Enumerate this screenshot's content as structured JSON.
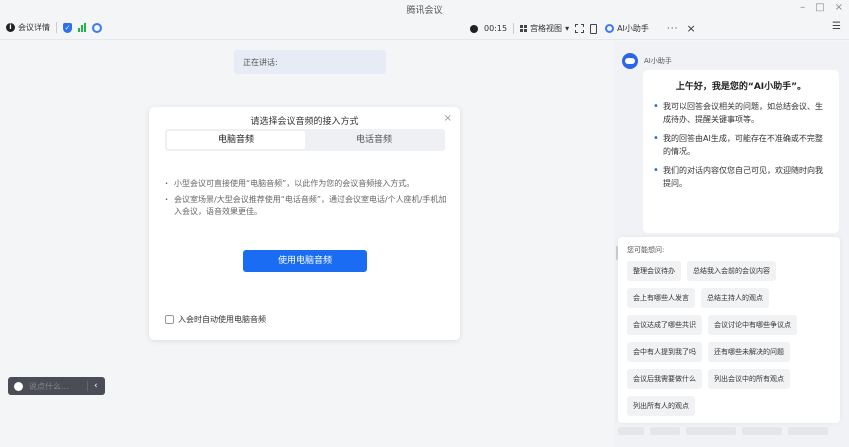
{
  "window": {
    "title": "腾讯会议",
    "controls": {
      "minimize": "–",
      "maximize": "□",
      "close": "×"
    }
  },
  "toolbar": {
    "meeting_info": "会议详情",
    "timer": "00:15",
    "view_mode": "宫格视图",
    "view_mode_caret": "▾",
    "ai_tab_label": "AI小助手",
    "more": "···",
    "tab_close": "×",
    "menu": "☰"
  },
  "main": {
    "speaking_label": "正在讲话:",
    "mini_chat_placeholder": "说点什么...",
    "mini_chat_chevron": "‹"
  },
  "audio_dialog": {
    "title": "请选择会议音频的接入方式",
    "close": "×",
    "tabs": [
      {
        "label": "电脑音频",
        "active": true
      },
      {
        "label": "电话音频",
        "active": false
      }
    ],
    "bullets": [
      "小型会议可直接使用“电脑音频”，以此作为您的会议音频接入方式。",
      "会议室场景/大型会议推荐使用“电话音频”，通过会议室电话/个人座机/手机加入会议，语音效果更佳。"
    ],
    "primary_button": "使用电脑音频",
    "auto_checkbox_label": "入会时自动使用电脑音频"
  },
  "ai_panel": {
    "name": "AI小助手",
    "greeting": "上午好，我是您的“AI小助手”。",
    "intro_items": [
      "我可以回答会议相关的问题，如总结会议、生成待办、提醒关键事项等。",
      "我的回答由AI生成，可能存在不准确或不完整的情况。",
      "我们的对话内容仅您自己可见，欢迎随时向我提问。"
    ],
    "suggest_title": "您可能想问:",
    "suggestions": [
      "整理会议待办",
      "总结我入会前的会议内容",
      "会上有哪些人发言",
      "总结主持人的观点",
      "会议达成了哪些共识",
      "会议讨论中有哪些争议点",
      "会中有人提到我了吗",
      "还有哪些未解决的问题",
      "会议后我需要做什么",
      "列出会议中的所有观点",
      "列出所有人的观点"
    ]
  },
  "colors": {
    "accent": "#1a6cf2",
    "bg": "#f4f5f7",
    "signal": "#22b14c"
  }
}
